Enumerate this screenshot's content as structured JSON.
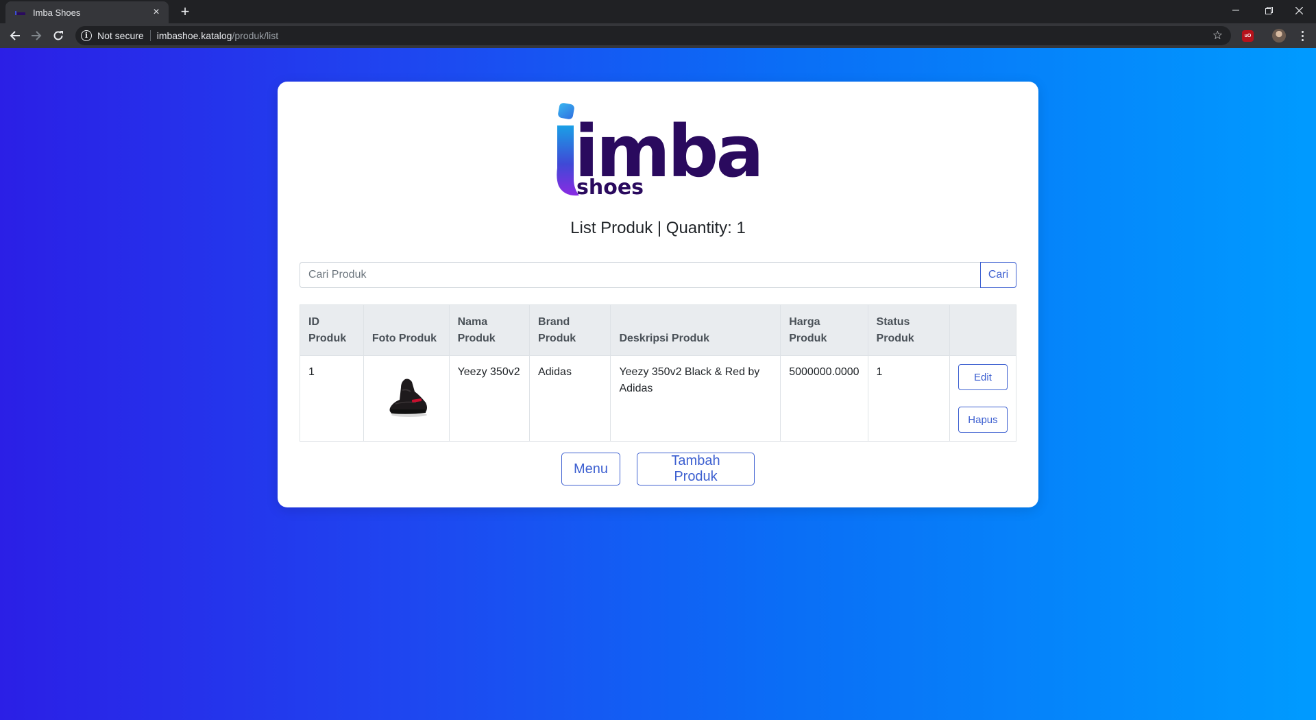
{
  "browser": {
    "tab_title": "Imba Shoes",
    "security_label": "Not secure",
    "url_host": "imbashoe.katalog",
    "url_path": "/produk/list",
    "extension_badge": "uO"
  },
  "logo": {
    "word": "imba",
    "sub": "shoes"
  },
  "page": {
    "subtitle": "List Produk | Quantity: 1"
  },
  "search": {
    "placeholder": "Cari Produk",
    "button_label": "Cari"
  },
  "table": {
    "headers": {
      "id": "ID Produk",
      "foto": "Foto Produk",
      "nama": "Nama Produk",
      "brand": "Brand Produk",
      "deskripsi": "Deskripsi Produk",
      "harga": "Harga Produk",
      "status": "Status Produk"
    },
    "rows": [
      {
        "id": "1",
        "nama": "Yeezy 350v2",
        "brand": "Adidas",
        "deskripsi": "Yeezy 350v2 Black & Red by Adidas",
        "harga": "5000000.0000",
        "status": "1",
        "edit_label": "Edit",
        "hapus_label": "Hapus"
      }
    ]
  },
  "actions": {
    "menu_label": "Menu",
    "add_label": "Tambah Produk"
  },
  "colors": {
    "accent": "#3c5fd0",
    "logo_dark": "#2a0a5e",
    "bg_left": "#2b1fe6",
    "bg_right": "#009bff"
  }
}
